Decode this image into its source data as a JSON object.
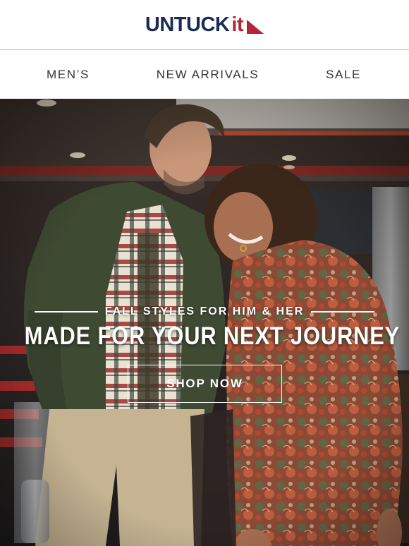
{
  "brand": {
    "logo_upper": "UNTUCK",
    "logo_lower": "it",
    "logo_mark": "red-flag-triangle",
    "colors": {
      "navy": "#1c2b52",
      "red": "#b32637"
    }
  },
  "nav": {
    "items": [
      {
        "label": "MEN’S"
      },
      {
        "label": "NEW ARRIVALS"
      },
      {
        "label": "SALE"
      }
    ]
  },
  "hero": {
    "image": "photo-couple-leaning-against-truck",
    "eyebrow": "FALL STYLES FOR HIM & HER",
    "headline": "MADE FOR YOUR NEXT JOURNEY",
    "cta_label": "SHOP NOW"
  }
}
